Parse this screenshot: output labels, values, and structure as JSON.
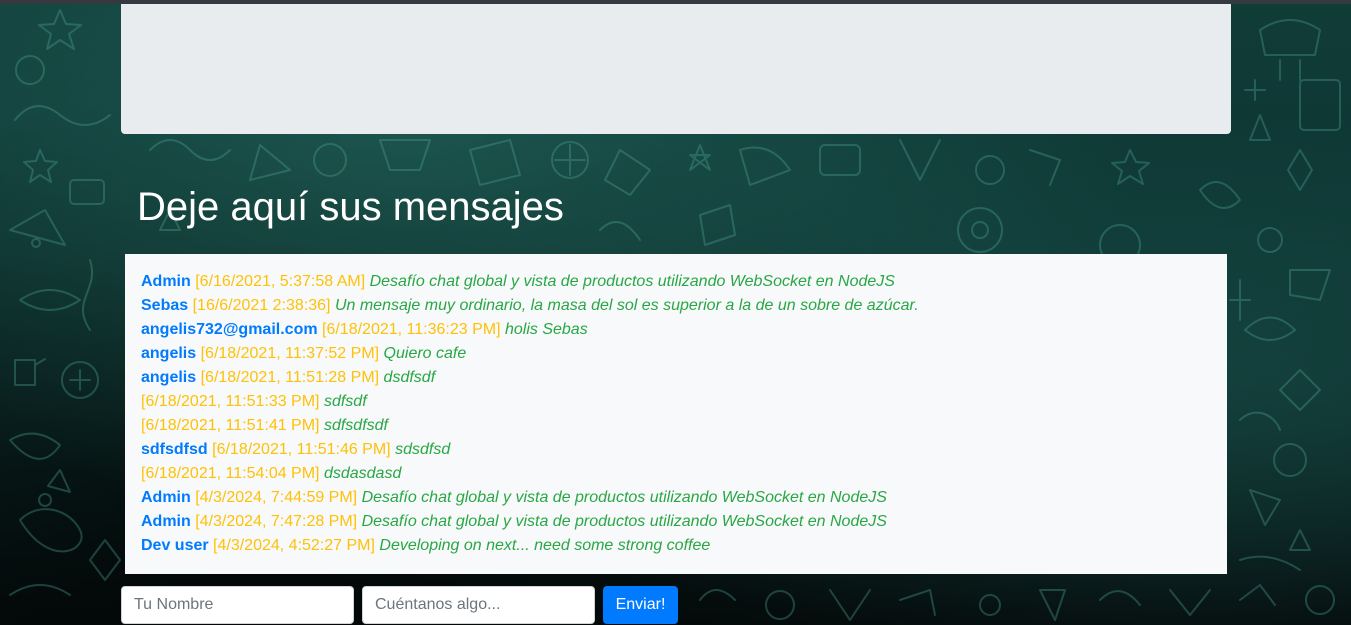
{
  "colors": {
    "author": "#007bff",
    "timestamp": "#ffc107",
    "message": "#28a745",
    "button": "#007bff",
    "panel": "#f8f9fa",
    "jumbotron": "#e9ecef"
  },
  "chat": {
    "title": "Deje aquí sus mensajes",
    "messages": [
      {
        "author": "Admin",
        "time": "[6/16/2021, 5:37:58 AM]",
        "text": "Desafío chat global y vista de productos utilizando WebSocket en NodeJS"
      },
      {
        "author": "Sebas",
        "time": "[16/6/2021 2:38:36]",
        "text": "Un mensaje muy ordinario, la masa del sol es superior a la de un sobre de azúcar."
      },
      {
        "author": "angelis732@gmail.com",
        "time": "[6/18/2021, 11:36:23 PM]",
        "text": "holis Sebas"
      },
      {
        "author": "angelis",
        "time": "[6/18/2021, 11:37:52 PM]",
        "text": "Quiero cafe"
      },
      {
        "author": "angelis",
        "time": "[6/18/2021, 11:51:28 PM]",
        "text": "dsdfsdf"
      },
      {
        "author": "",
        "time": "[6/18/2021, 11:51:33 PM]",
        "text": "sdfsdf"
      },
      {
        "author": "",
        "time": "[6/18/2021, 11:51:41 PM]",
        "text": "sdfsdfsdf"
      },
      {
        "author": "sdfsdfsd",
        "time": "[6/18/2021, 11:51:46 PM]",
        "text": "sdsdfsd"
      },
      {
        "author": "",
        "time": "[6/18/2021, 11:54:04 PM]",
        "text": "dsdasdasd"
      },
      {
        "author": "Admin",
        "time": "[4/3/2024, 7:44:59 PM]",
        "text": "Desafío chat global y vista de productos utilizando WebSocket en NodeJS"
      },
      {
        "author": "Admin",
        "time": "[4/3/2024, 7:47:28 PM]",
        "text": "Desafío chat global y vista de productos utilizando WebSocket en NodeJS"
      },
      {
        "author": "Dev user",
        "time": "[4/3/2024, 4:52:27 PM]",
        "text": "Developing on next... need some strong coffee"
      }
    ]
  },
  "form": {
    "name_placeholder": "Tu Nombre",
    "name_value": "",
    "message_placeholder": "Cuéntanos algo...",
    "message_value": "",
    "submit_label": "Enviar!"
  }
}
